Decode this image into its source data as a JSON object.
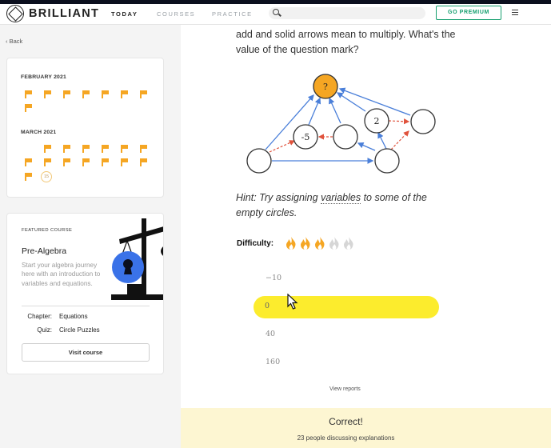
{
  "nav": {
    "logo_text": "BRILLIANT",
    "links": [
      "TODAY",
      "COURSES",
      "PRACTICE"
    ],
    "premium_label": "GO PREMIUM"
  },
  "sidebar": {
    "back_label": "Back",
    "calendar": {
      "months": [
        {
          "label": "FEBRUARY 2021",
          "completed": 8
        },
        {
          "label": "MARCH 2021",
          "completed": 14,
          "current_day": "15"
        }
      ]
    },
    "featured": {
      "tag": "FEATURED COURSE",
      "title": "Pre-Algebra",
      "description": "Start your algebra journey here with an introduction to variables and equations.",
      "chapter_label": "Chapter:",
      "chapter_value": "Equations",
      "quiz_label": "Quiz:",
      "quiz_value": "Circle Puzzles",
      "visit_label": "Visit course"
    }
  },
  "problem": {
    "prompt": "add and solid arrows mean to multiply. What's the value of the question mark?",
    "diagram_labels": {
      "top": "?",
      "left": "-5",
      "right": "2"
    },
    "hint_prefix": "Hint: Try assigning ",
    "hint_link": "variables",
    "hint_suffix": " to some of the empty circles.",
    "difficulty_label": "Difficulty:",
    "difficulty_level": 3,
    "difficulty_max": 5,
    "options": [
      "−10",
      "0",
      "40",
      "160"
    ],
    "selected_option": "0",
    "view_reports": "View reports"
  },
  "feedback": {
    "result": "Correct!",
    "discussion": "23 people discussing explanations"
  },
  "colors": {
    "accent_flag": "#f5a623",
    "premium_green": "#18a070",
    "selected_yellow": "#fcec2d",
    "feedback_bg": "#fdf6d2",
    "solid_arrow": "#4a7fd9",
    "dashed_arrow": "#e0533d",
    "question_node": "#f5a623"
  }
}
